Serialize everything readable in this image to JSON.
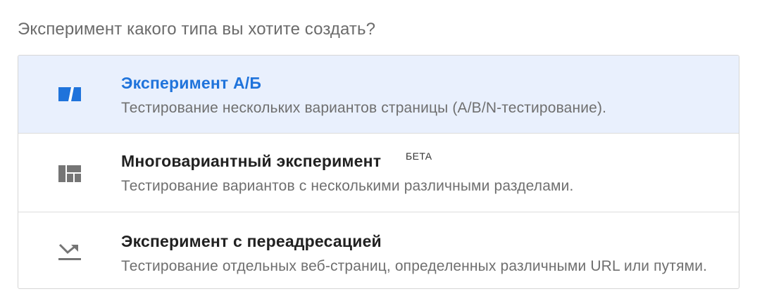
{
  "prompt": "Эксперимент какого типа вы хотите создать?",
  "colors": {
    "accent": "#1f73db",
    "selected_bg": "#e9f0fd",
    "icon_gray": "#757575"
  },
  "options": [
    {
      "icon": "ab-test-icon",
      "title": "Эксперимент А/Б",
      "badge": "",
      "description": "Тестирование нескольких вариантов страницы (A/B/N-тестирование).",
      "selected": true
    },
    {
      "icon": "multivariate-grid-icon",
      "title": "Многовариантный эксперимент",
      "badge": "БЕТА",
      "description": "Тестирование вариантов с несколькими различными разделами.",
      "selected": false
    },
    {
      "icon": "redirect-arrow-icon",
      "title": "Эксперимент с переадресацией",
      "badge": "",
      "description": "Тестирование отдельных веб-страниц, определенных различными URL или путями.",
      "selected": false
    }
  ]
}
